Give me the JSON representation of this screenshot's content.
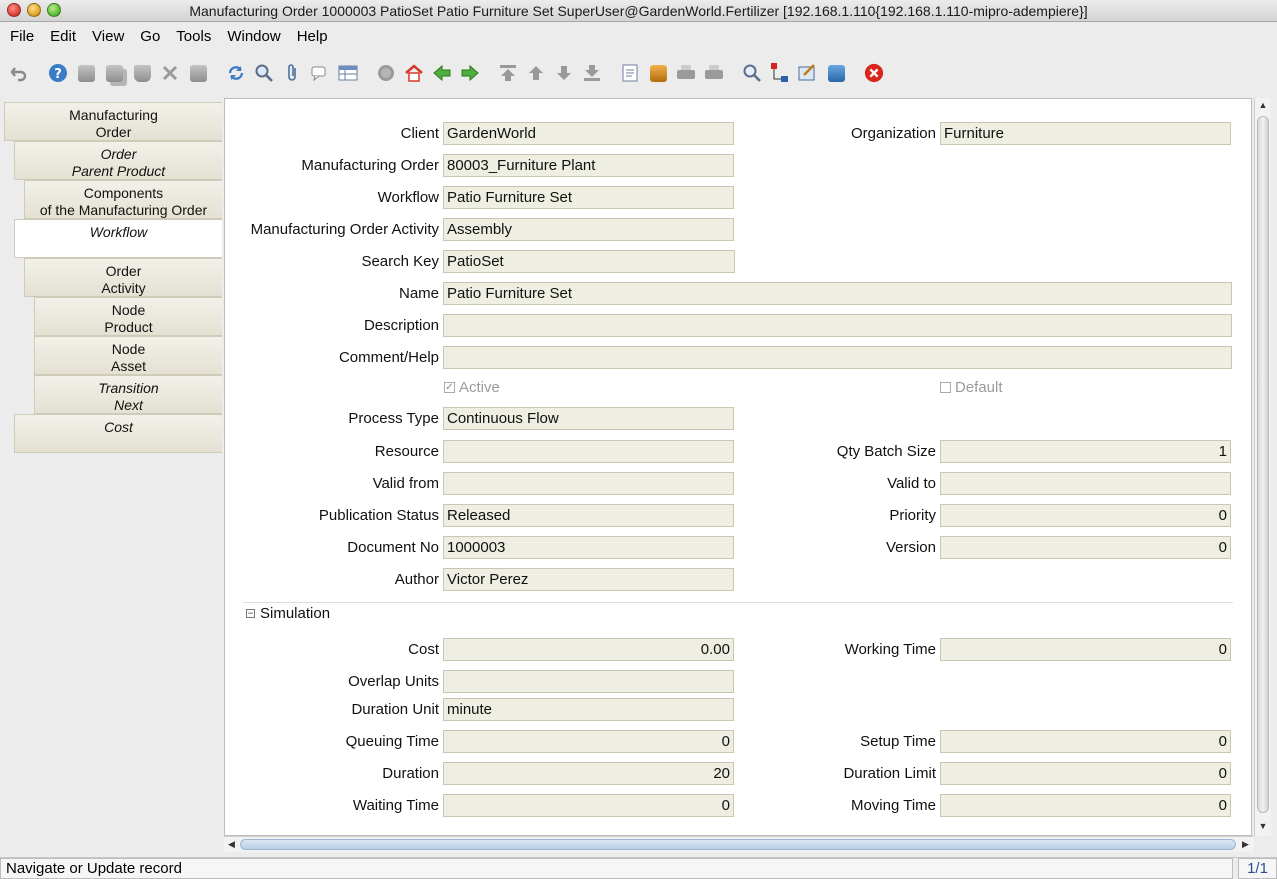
{
  "window": {
    "title": "Manufacturing Order  1000003  PatioSet  Patio Furniture Set  SuperUser@GardenWorld.Fertilizer [192.168.1.110{192.168.1.110-mipro-adempiere}]"
  },
  "menu": {
    "items": [
      {
        "name": "menu-file",
        "label": "File"
      },
      {
        "name": "menu-edit",
        "label": "Edit"
      },
      {
        "name": "menu-view",
        "label": "View"
      },
      {
        "name": "menu-go",
        "label": "Go"
      },
      {
        "name": "menu-tools",
        "label": "Tools"
      },
      {
        "name": "menu-window",
        "label": "Window"
      },
      {
        "name": "menu-help",
        "label": "Help"
      }
    ]
  },
  "toolbar": {
    "icons": [
      "undo-icon",
      "help-icon",
      "new-record-icon",
      "copy-record-icon",
      "delete-icon",
      "delete-selection-icon",
      "save-icon",
      "refresh-icon",
      "find-icon",
      "attachment-icon",
      "chat-icon",
      "grid-toggle-icon",
      "history-icon",
      "home-icon",
      "parent-icon",
      "detail-icon",
      "first-record-icon",
      "previous-record-icon",
      "next-record-icon",
      "last-record-icon",
      "report-icon",
      "archive-icon",
      "print-preview-icon",
      "print-icon",
      "zoom-across-icon",
      "workflow-icon",
      "request-icon",
      "product-info-icon",
      "end-icon"
    ]
  },
  "tabs": [
    {
      "label1": "Manufacturing",
      "label2": "Order"
    },
    {
      "label1": "Order",
      "label2": "Parent Product"
    },
    {
      "label1": "Components",
      "label2": "of the Manufacturing Order"
    },
    {
      "label1": "Workflow",
      "label2": ""
    },
    {
      "label1": "Order",
      "label2": "Activity"
    },
    {
      "label1": "Node",
      "label2": "Product"
    },
    {
      "label1": "Node",
      "label2": "Asset"
    },
    {
      "label1": "Transition",
      "label2": "Next"
    },
    {
      "label1": "Cost",
      "label2": ""
    }
  ],
  "form": {
    "client": {
      "label": "Client",
      "value": "GardenWorld"
    },
    "organization": {
      "label": "Organization",
      "value": "Furniture"
    },
    "manufacturing_order": {
      "label": "Manufacturing Order",
      "value": "80003_Furniture Plant"
    },
    "workflow": {
      "label": "Workflow",
      "value": "Patio Furniture Set"
    },
    "mo_activity": {
      "label": "Manufacturing Order Activity",
      "value": "Assembly"
    },
    "search_key": {
      "label": "Search Key",
      "value": "PatioSet"
    },
    "name": {
      "label": "Name",
      "value": "Patio Furniture Set"
    },
    "description": {
      "label": "Description",
      "value": ""
    },
    "comment_help": {
      "label": "Comment/Help",
      "value": ""
    },
    "active": {
      "label": "Active",
      "checked": true
    },
    "default": {
      "label": "Default",
      "checked": false
    },
    "process_type": {
      "label": "Process Type",
      "value": "Continuous Flow"
    },
    "resource": {
      "label": "Resource",
      "value": ""
    },
    "qty_batch_size": {
      "label": "Qty Batch Size",
      "value": "1"
    },
    "valid_from": {
      "label": "Valid from",
      "value": ""
    },
    "valid_to": {
      "label": "Valid to",
      "value": ""
    },
    "publication_status": {
      "label": "Publication Status",
      "value": "Released"
    },
    "priority": {
      "label": "Priority",
      "value": "0"
    },
    "document_no": {
      "label": "Document No",
      "value": "1000003"
    },
    "version": {
      "label": "Version",
      "value": "0"
    },
    "author": {
      "label": "Author",
      "value": "Victor Perez"
    }
  },
  "simulation": {
    "title": "Simulation",
    "cost": {
      "label": "Cost",
      "value": "0.00"
    },
    "working_time": {
      "label": "Working Time",
      "value": "0"
    },
    "overlap_units": {
      "label": "Overlap Units",
      "value": ""
    },
    "duration_unit": {
      "label": "Duration Unit",
      "value": "minute"
    },
    "queuing_time": {
      "label": "Queuing Time",
      "value": "0"
    },
    "setup_time": {
      "label": "Setup Time",
      "value": "0"
    },
    "duration": {
      "label": "Duration",
      "value": "20"
    },
    "duration_limit": {
      "label": "Duration Limit",
      "value": "0"
    },
    "waiting_time": {
      "label": "Waiting Time",
      "value": "0"
    },
    "moving_time": {
      "label": "Moving Time",
      "value": "0"
    }
  },
  "status": {
    "message": "Navigate or Update record",
    "record_count": "1/1"
  }
}
